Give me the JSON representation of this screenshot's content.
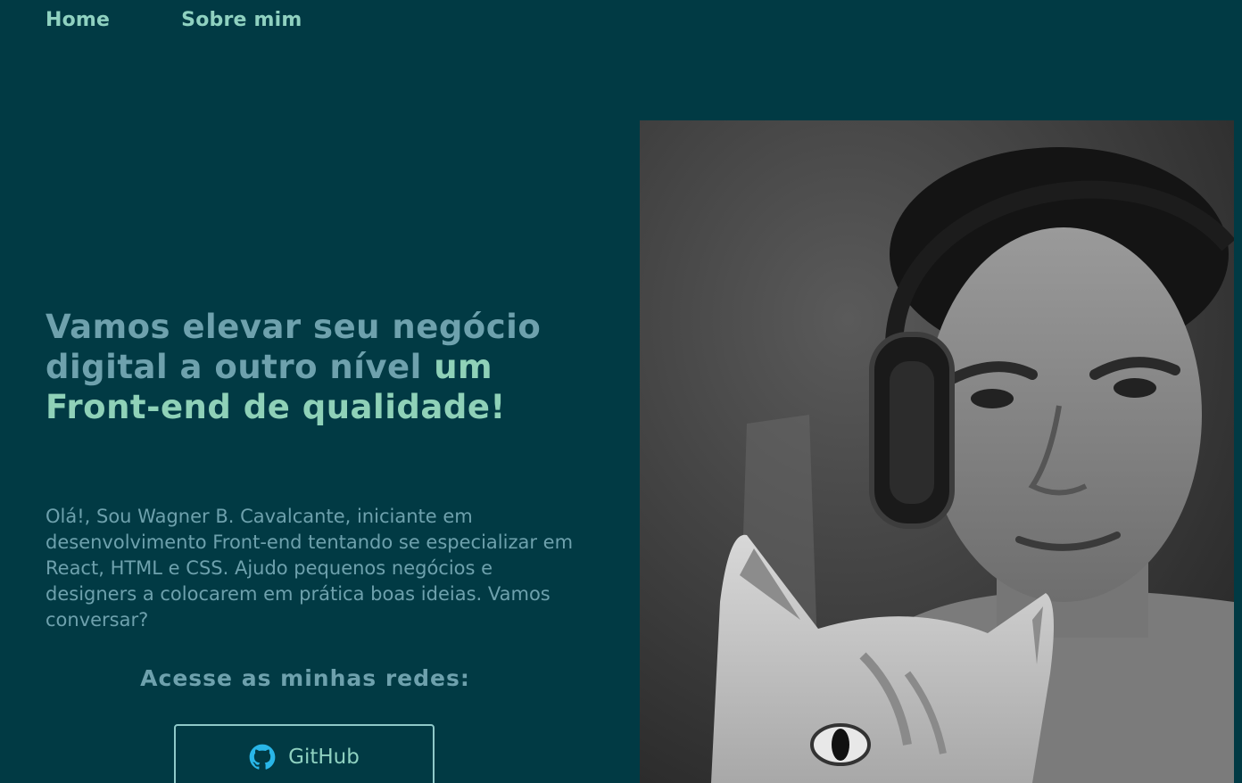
{
  "nav": {
    "home": "Home",
    "about": "Sobre mim"
  },
  "hero": {
    "headline_part1": "Vamos elevar seu negócio digital a outro nível ",
    "headline_accent": "um Front-end de qualidade!",
    "intro": "Olá!, Sou Wagner B. Cavalcante, iniciante em desenvolvimento Front-end tentando se especializar em React, HTML e CSS. Ajudo pequenos negócios e designers a colocarem em prática boas ideias. Vamos conversar?",
    "networks_title": "Acesse as minhas redes:",
    "github_label": "GitHub"
  },
  "icons": {
    "github": "github-icon"
  },
  "colors": {
    "background": "#013a44",
    "text_muted": "#6ea1ad",
    "accent": "#8fd1b8",
    "github_icon": "#29b6e8"
  }
}
